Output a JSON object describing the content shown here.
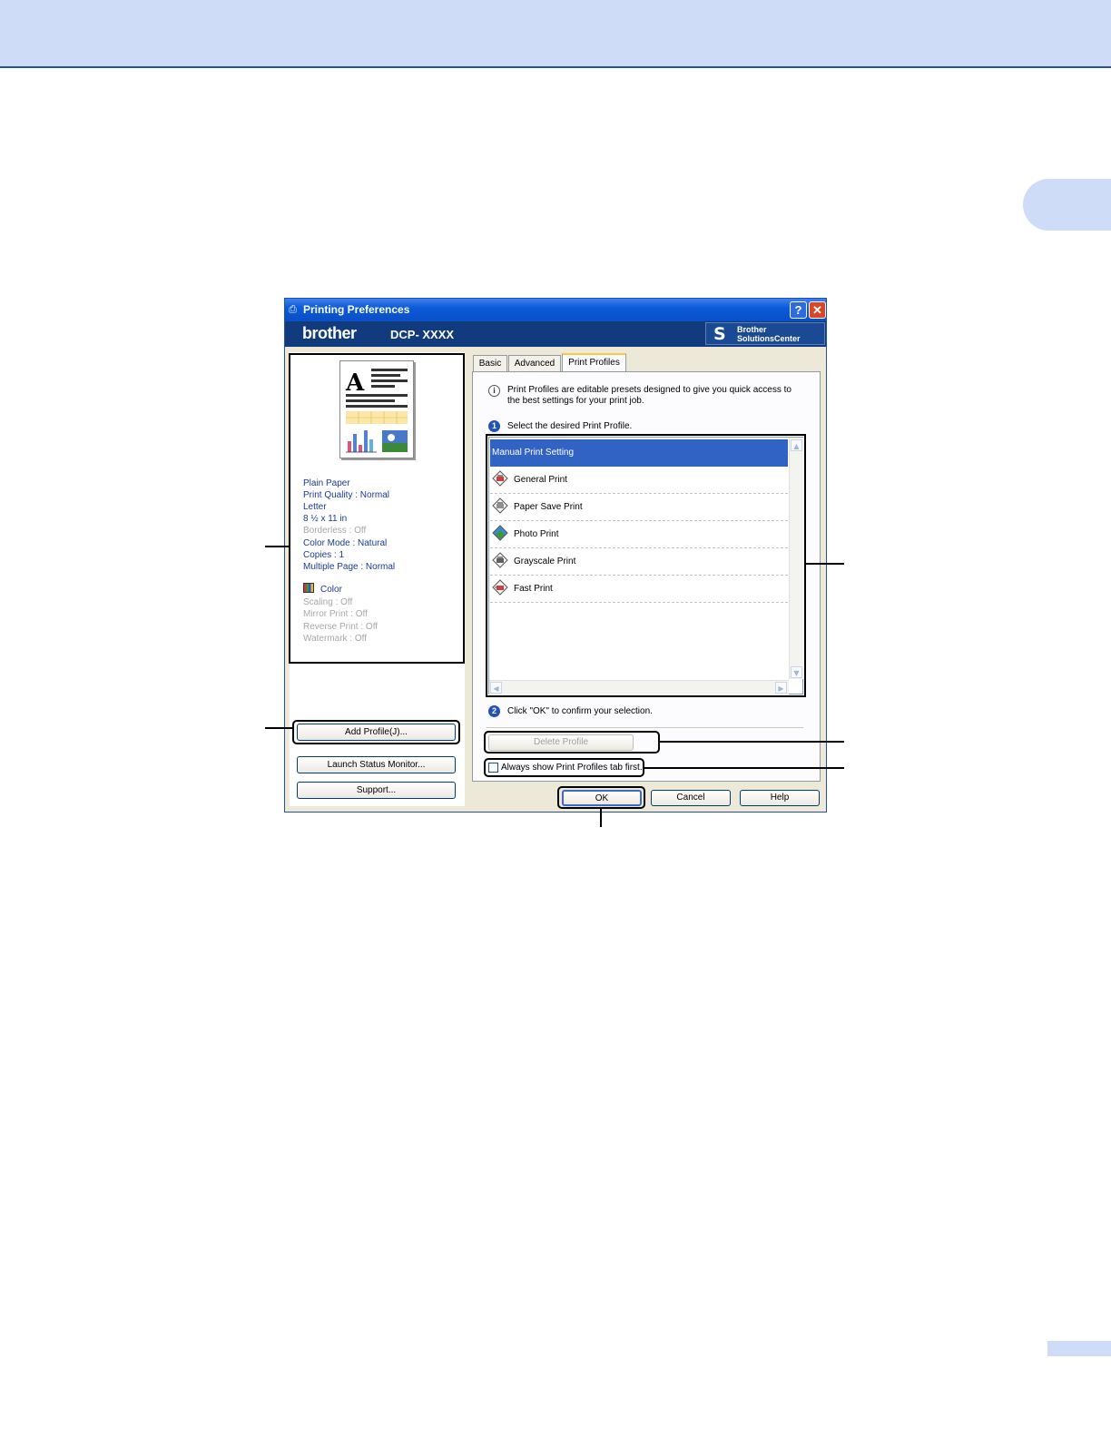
{
  "dialog": {
    "title": "Printing Preferences",
    "help_glyph": "?",
    "close_glyph": "✕",
    "brand": "brother",
    "model": "DCP- XXXX",
    "solutions_line1": "Brother",
    "solutions_line2": "SolutionsCenter"
  },
  "preview": {
    "settings": [
      {
        "text": "Plain Paper",
        "enabled": true
      },
      {
        "text": "Print Quality : Normal",
        "enabled": true
      },
      {
        "text": "Letter",
        "enabled": true
      },
      {
        "text": "8 ½ x 11 in",
        "enabled": true
      },
      {
        "text": "Borderless : Off",
        "enabled": false
      },
      {
        "text": "Color Mode : Natural",
        "enabled": true
      },
      {
        "text": "Copies : 1",
        "enabled": true
      },
      {
        "text": "Multiple Page : Normal",
        "enabled": true
      }
    ],
    "color_label": "Color",
    "extra_settings": [
      {
        "text": "Scaling : Off",
        "enabled": false
      },
      {
        "text": "Mirror Print : Off",
        "enabled": false
      },
      {
        "text": "Reverse Print : Off",
        "enabled": false
      },
      {
        "text": "Watermark : Off",
        "enabled": false
      }
    ]
  },
  "left_buttons": {
    "add_profile": "Add Profile(J)...",
    "launch_status_monitor": "Launch Status Monitor...",
    "support": "Support..."
  },
  "tabs": [
    {
      "label": "Basic",
      "active": false
    },
    {
      "label": "Advanced",
      "active": false
    },
    {
      "label": "Print Profiles",
      "active": true
    }
  ],
  "profiles_tab": {
    "intro": "Print Profiles are editable presets designed to give you quick access to the best settings for your print job.",
    "step1_number": "1",
    "step1_text": "Select the desired Print Profile.",
    "items": [
      {
        "label": "Manual Print Setting",
        "icon": "none",
        "selected": true
      },
      {
        "label": "General Print",
        "icon": "general-print-icon",
        "selected": false
      },
      {
        "label": "Paper Save Print",
        "icon": "paper-save-print-icon",
        "selected": false
      },
      {
        "label": "Photo Print",
        "icon": "photo-print-icon",
        "selected": false
      },
      {
        "label": "Grayscale Print",
        "icon": "grayscale-print-icon",
        "selected": false
      },
      {
        "label": "Fast Print",
        "icon": "fast-print-icon",
        "selected": false
      }
    ],
    "step2_number": "2",
    "step2_text": "Click \"OK\" to confirm your selection.",
    "delete_profile": "Delete Profile",
    "always_show": "Always show Print Profiles tab first.",
    "always_show_checked": false
  },
  "bottom_buttons": {
    "ok": "OK",
    "cancel": "Cancel",
    "help": "Help"
  },
  "colors": {
    "header_band": "#cfdcf8",
    "title_bar": "#0b5ad8",
    "brand_bar": "#123b7e",
    "selection": "#3163c5",
    "info_text": "#1a3a96"
  }
}
